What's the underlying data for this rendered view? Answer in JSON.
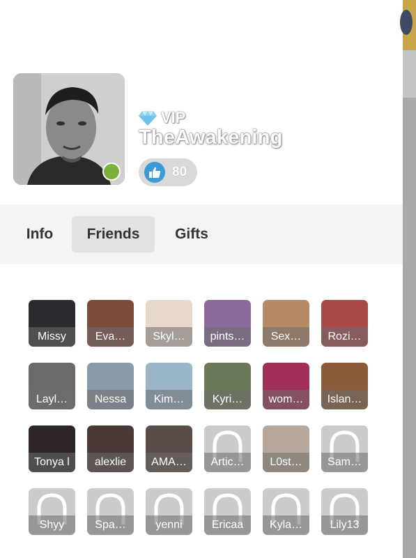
{
  "profile": {
    "vip_label": "VIP",
    "username": "TheAwakening",
    "likes": "80",
    "online": true
  },
  "tabs": [
    {
      "label": "Info",
      "active": false
    },
    {
      "label": "Friends",
      "active": true
    },
    {
      "label": "Gifts",
      "active": false
    }
  ],
  "friends": [
    {
      "name": "Missy",
      "photo": true
    },
    {
      "name": "Eva…",
      "photo": true
    },
    {
      "name": "Skyl…",
      "photo": true
    },
    {
      "name": "pints…",
      "photo": true
    },
    {
      "name": "Sex…",
      "photo": true
    },
    {
      "name": "Rozi…",
      "photo": true
    },
    {
      "name": "Layl…",
      "photo": true
    },
    {
      "name": "Nessa",
      "photo": true
    },
    {
      "name": "Kim…",
      "photo": true
    },
    {
      "name": "Kyri…",
      "photo": true
    },
    {
      "name": "wom…",
      "photo": true
    },
    {
      "name": "Islan…",
      "photo": true
    },
    {
      "name": "Tonya l",
      "photo": true
    },
    {
      "name": "alexlie",
      "photo": true
    },
    {
      "name": "AMA…",
      "photo": true
    },
    {
      "name": "Artic…",
      "photo": false
    },
    {
      "name": "L0st…",
      "photo": true
    },
    {
      "name": "Sam…",
      "photo": false
    },
    {
      "name": "Shyy",
      "photo": false
    },
    {
      "name": "Spa…",
      "photo": false
    },
    {
      "name": "yenni",
      "photo": false
    },
    {
      "name": "Ericaa",
      "photo": false
    },
    {
      "name": "Kyla…",
      "photo": false
    },
    {
      "name": "Lily13",
      "photo": false
    }
  ],
  "colors": {
    "like_blue": "#3b9ad8",
    "online_green": "#7bb33a",
    "vip_diamond": "#8fd3f0"
  },
  "icons": {
    "vip": "diamond-icon",
    "likes": "thumbs-up-icon",
    "placeholder": "default-avatar-icon"
  }
}
